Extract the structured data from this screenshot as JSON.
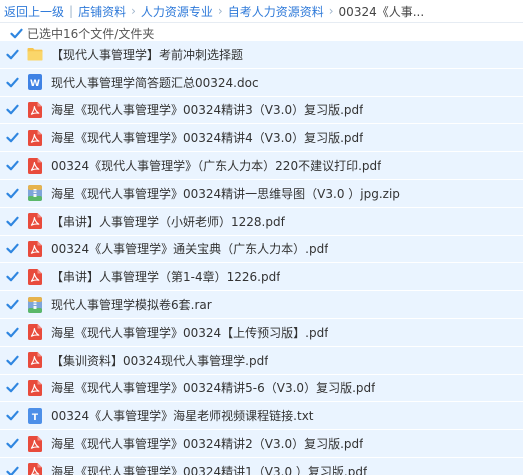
{
  "breadcrumb": {
    "back_label": "返回上一级",
    "separator": "|",
    "items": [
      "店铺资料",
      "人力资源专业",
      "自考人力资源资料"
    ],
    "current": "00324《人事..."
  },
  "selection": {
    "summary": "已选中16个文件/文件夹"
  },
  "colors": {
    "check": "#2f86e0",
    "row_selected_bg": "#eaf4ff",
    "link": "#2f7ad9"
  },
  "files": [
    {
      "icon": "folder-icon",
      "name": "【现代人事管理学】考前冲刺选择题"
    },
    {
      "icon": "word-doc-icon",
      "name": "现代人事管理学简答题汇总00324.doc"
    },
    {
      "icon": "pdf-icon",
      "name": "海星《现代人事管理学》00324精讲3（V3.0）复习版.pdf"
    },
    {
      "icon": "pdf-icon",
      "name": "海星《现代人事管理学》00324精讲4（V3.0）复习版.pdf"
    },
    {
      "icon": "pdf-icon",
      "name": "00324《现代人事管理学》（广东人力本）220不建议打印.pdf"
    },
    {
      "icon": "zip-archive-icon",
      "name": "海星《现代人事管理学》00324精讲一思维导图（V3.0 ）jpg.zip"
    },
    {
      "icon": "pdf-icon",
      "name": "【串讲】人事管理学（小妍老师）1228.pdf"
    },
    {
      "icon": "pdf-icon",
      "name": "00324《人事管理学》通关宝典（广东人力本）.pdf"
    },
    {
      "icon": "pdf-icon",
      "name": "【串讲】人事管理学（第1-4章）1226.pdf"
    },
    {
      "icon": "rar-archive-icon",
      "name": "现代人事管理学模拟卷6套.rar"
    },
    {
      "icon": "pdf-icon",
      "name": "海星《现代人事管理学》00324【上传预习版】.pdf"
    },
    {
      "icon": "pdf-icon",
      "name": "【集训资料】00324现代人事管理学.pdf"
    },
    {
      "icon": "pdf-icon",
      "name": "海星《现代人事管理学》00324精讲5-6（V3.0）复习版.pdf"
    },
    {
      "icon": "txt-file-icon",
      "name": "00324《人事管理学》海星老师视频课程链接.txt"
    },
    {
      "icon": "pdf-icon",
      "name": "海星《现代人事管理学》00324精讲2（V3.0）复习版.pdf"
    },
    {
      "icon": "pdf-icon",
      "name": "海星《现代人事管理学》00324精讲1（V3.0 ）复习版.pdf"
    }
  ]
}
